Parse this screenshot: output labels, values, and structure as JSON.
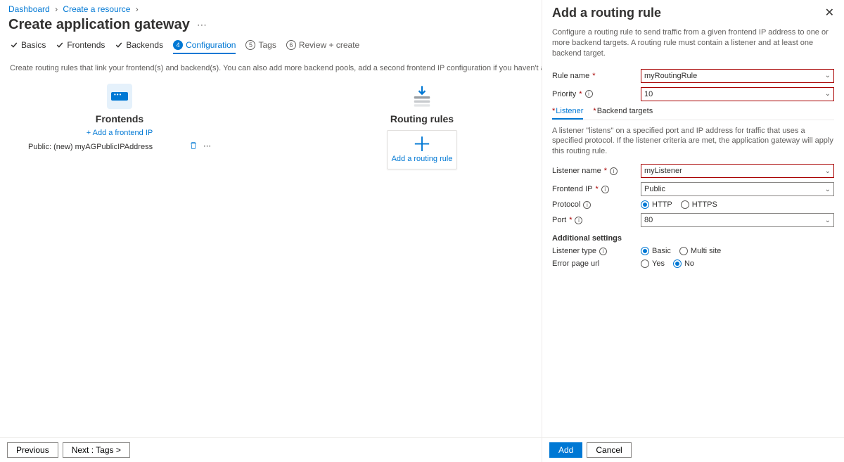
{
  "breadcrumb": {
    "items": [
      "Dashboard",
      "Create a resource"
    ]
  },
  "page": {
    "title": "Create application gateway"
  },
  "wizard": {
    "tabs": {
      "basics": "Basics",
      "frontends": "Frontends",
      "backends": "Backends",
      "configuration": "Configuration",
      "tags_num": "5",
      "tags": "Tags",
      "review_num": "6",
      "review": "Review + create"
    },
    "instructions": "Create routing rules that link your frontend(s) and backend(s). You can also add more backend pools, add a second frontend IP configuration if you haven't already, or edit previous configurations."
  },
  "frontends": {
    "title": "Frontends",
    "add_link": "+ Add a frontend IP",
    "item_label": "Public: (new) myAGPublicIPAddress"
  },
  "routing": {
    "title": "Routing rules",
    "add_label": "Add a routing rule"
  },
  "footer": {
    "previous": "Previous",
    "next": "Next : Tags >"
  },
  "panel": {
    "title": "Add a routing rule",
    "description": "Configure a routing rule to send traffic from a given frontend IP address to one or more backend targets. A routing rule must contain a listener and at least one backend target.",
    "rule_name_label": "Rule name",
    "rule_name_value": "myRoutingRule",
    "priority_label": "Priority",
    "priority_value": "10",
    "tabs": {
      "listener": "Listener",
      "backend": "Backend targets"
    },
    "listener_desc": "A listener \"listens\" on a specified port and IP address for traffic that uses a specified protocol. If the listener criteria are met, the application gateway will apply this routing rule.",
    "listener_name_label": "Listener name",
    "listener_name_value": "myListener",
    "frontend_ip_label": "Frontend IP",
    "frontend_ip_value": "Public",
    "protocol_label": "Protocol",
    "protocol_http": "HTTP",
    "protocol_https": "HTTPS",
    "port_label": "Port",
    "port_value": "80",
    "additional_h": "Additional settings",
    "listener_type_label": "Listener type",
    "listener_type_basic": "Basic",
    "listener_type_multi": "Multi site",
    "error_page_label": "Error page url",
    "error_yes": "Yes",
    "error_no": "No",
    "add_btn": "Add",
    "cancel_btn": "Cancel"
  }
}
